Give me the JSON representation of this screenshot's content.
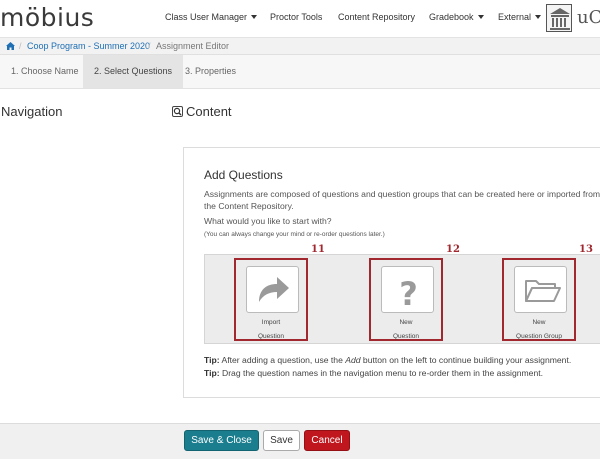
{
  "app": {
    "logo_text": "möbius",
    "institution_text": "uC"
  },
  "topnav": {
    "items": [
      {
        "label": "Class User Manager",
        "dropdown": true
      },
      {
        "label": "Proctor Tools",
        "dropdown": false
      },
      {
        "label": "Content Repository",
        "dropdown": false
      },
      {
        "label": "Gradebook",
        "dropdown": true
      },
      {
        "label": "External",
        "dropdown": true
      }
    ]
  },
  "breadcrumb": {
    "home_icon": "home-icon",
    "course": "Coop Program - Summer 2020",
    "current": "Assignment Editor"
  },
  "steps": [
    {
      "label": "1. Choose Name",
      "active": false
    },
    {
      "label": "2. Select Questions",
      "active": true
    },
    {
      "label": "3. Properties",
      "active": false
    }
  ],
  "navigation": {
    "heading": "Navigation"
  },
  "content": {
    "heading": "Content",
    "icon": "search-icon"
  },
  "panel": {
    "title": "Add Questions",
    "description": "Assignments are composed of questions and question groups that can be created here or imported from the Content Repository.",
    "question": "What would you like to start with?",
    "note": "(You can always change your mind or re-order questions later.)",
    "choices": [
      {
        "line1": "Import",
        "line2": "Question",
        "icon": "share-arrow-icon",
        "marker": "11"
      },
      {
        "line1": "New",
        "line2": "Question",
        "icon": "question-mark-icon",
        "marker": "12"
      },
      {
        "line1": "New",
        "line2": "Question Group",
        "icon": "folder-open-icon",
        "marker": "13"
      }
    ],
    "tip1": {
      "label": "Tip:",
      "before": " After adding a question, use the ",
      "em": "Add",
      "after": " button on the left to continue building your assignment."
    },
    "tip2": {
      "label": "Tip:",
      "text": " Drag the question names in the navigation menu to re-order them in the assignment."
    }
  },
  "footer": {
    "save_close": "Save & Close",
    "save": "Save",
    "cancel": "Cancel"
  },
  "colors": {
    "accent": "#1a7e8f",
    "danger": "#c0161e",
    "marker": "#a0282e",
    "link": "#1f6fb5"
  }
}
